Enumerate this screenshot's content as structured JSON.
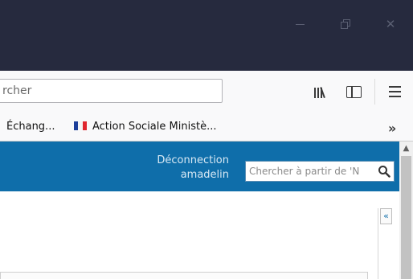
{
  "window": {
    "controls": [
      "minimize-icon",
      "restore-icon",
      "close-icon"
    ]
  },
  "navbar": {
    "url_text": "rcher",
    "icons": [
      "library-icon",
      "sidebar-icon",
      "menu-icon"
    ]
  },
  "bookmarks": {
    "items": [
      {
        "label": "Échang..."
      },
      {
        "label": "Action Sociale Ministè...",
        "icon": "flag-icon"
      }
    ],
    "overflow": "»"
  },
  "header": {
    "logout_label": "Déconnection",
    "username": "amadelin",
    "search_placeholder": "Chercher à partir de 'N",
    "colors": {
      "accent": "#0f6eaa"
    }
  },
  "content": {
    "collapse_label": "«"
  }
}
